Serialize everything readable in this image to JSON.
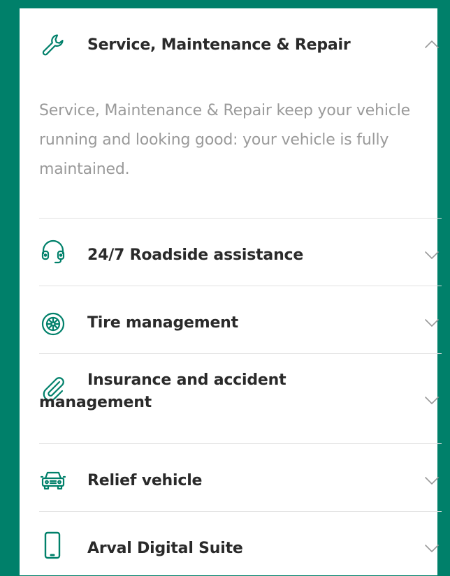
{
  "accent_color": "#00806a",
  "accordion": {
    "open_item": {
      "title": "Service, Maintenance & Repair",
      "icon": "wrench-icon",
      "description": "Service, Maintenance & Repair keep your vehicle running and looking good: your vehicle is fully maintained.",
      "state": "expanded"
    },
    "items": [
      {
        "title": "24/7 Roadside assistance",
        "icon": "headset-icon",
        "state": "collapsed"
      },
      {
        "title": "Tire management",
        "icon": "tire-icon",
        "state": "collapsed"
      },
      {
        "title": "Insurance and accident management",
        "icon": "paperclip-icon",
        "state": "collapsed"
      },
      {
        "title": "Relief vehicle",
        "icon": "car-icon",
        "state": "collapsed"
      },
      {
        "title": "Arval Digital Suite",
        "icon": "smartphone-icon",
        "state": "collapsed"
      }
    ]
  }
}
